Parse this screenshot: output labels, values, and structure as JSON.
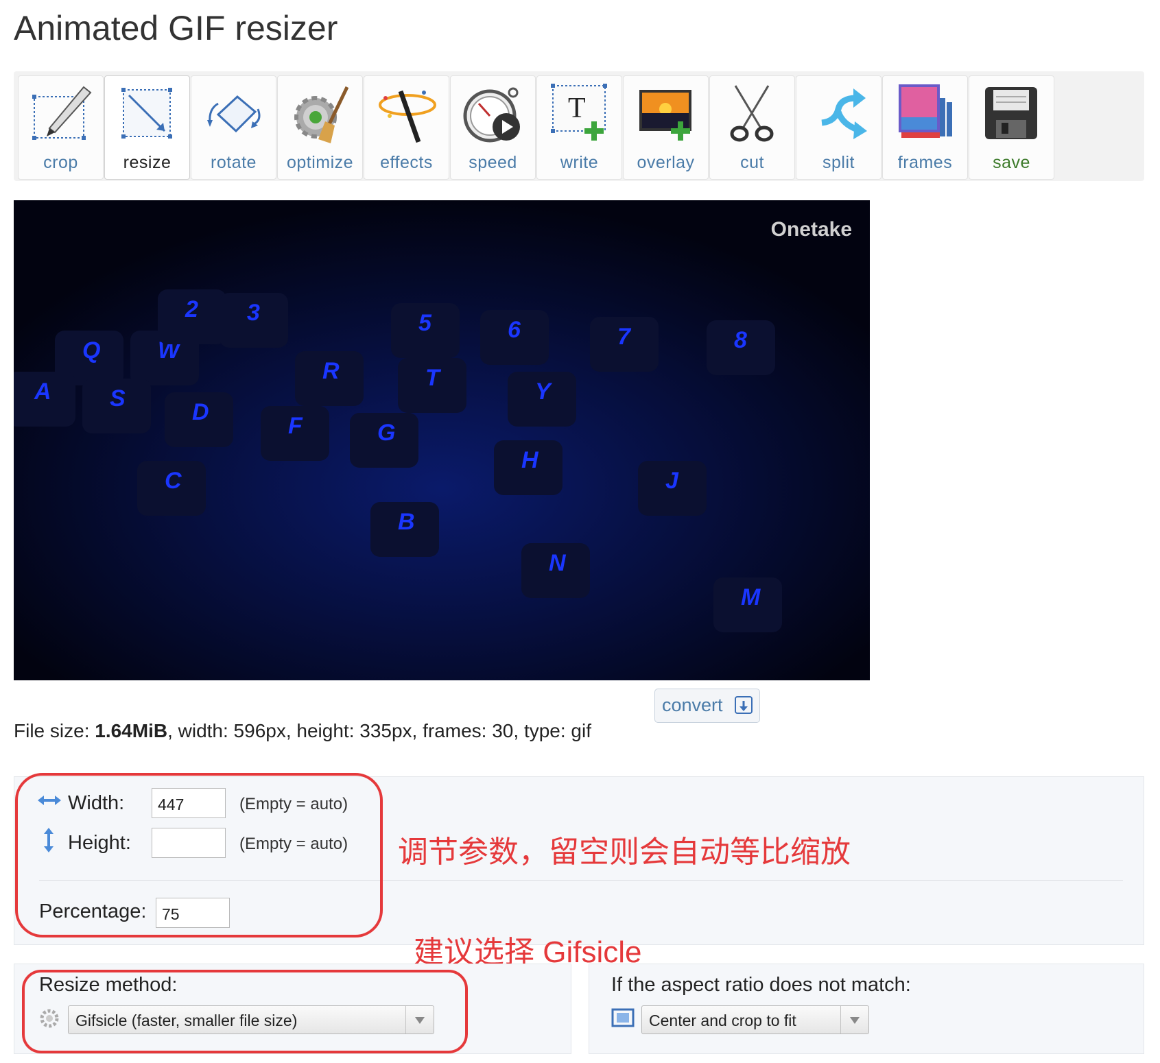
{
  "page": {
    "title": "Animated GIF resizer"
  },
  "toolbar": [
    {
      "label": "crop",
      "icon": "crop-icon"
    },
    {
      "label": "resize",
      "icon": "resize-icon"
    },
    {
      "label": "rotate",
      "icon": "rotate-icon"
    },
    {
      "label": "optimize",
      "icon": "optimize-icon"
    },
    {
      "label": "effects",
      "icon": "effects-icon"
    },
    {
      "label": "speed",
      "icon": "speed-icon"
    },
    {
      "label": "write",
      "icon": "write-icon"
    },
    {
      "label": "overlay",
      "icon": "overlay-icon"
    },
    {
      "label": "cut",
      "icon": "cut-icon"
    },
    {
      "label": "split",
      "icon": "split-icon"
    },
    {
      "label": "frames",
      "icon": "frames-icon"
    },
    {
      "label": "save",
      "icon": "save-icon"
    }
  ],
  "preview": {
    "watermark": "Onetake",
    "keys": [
      "Q",
      "W",
      "R",
      "T",
      "Y",
      "A",
      "S",
      "D",
      "F",
      "G",
      "H",
      "J",
      "C",
      "B",
      "N",
      "M",
      "2",
      "3",
      "5",
      "6",
      "7",
      "8"
    ]
  },
  "convert": {
    "label": "convert"
  },
  "fileinfo": {
    "prefix": "File size: ",
    "size": "1.64MiB",
    "rest": ", width: 596px, height: 335px, frames: 30, type: gif"
  },
  "resize": {
    "width_label": "Width:",
    "width_value": "447",
    "width_hint": "(Empty = auto)",
    "height_label": "Height:",
    "height_value": "",
    "height_hint": "(Empty = auto)",
    "percentage_label": "Percentage:",
    "percentage_value": "75"
  },
  "annotations": {
    "note1": "调节参数，留空则会自动等比缩放",
    "note2": "建议选择 Gifsicle"
  },
  "method": {
    "label": "Resize method:",
    "selected": "Gifsicle (faster, smaller file size)"
  },
  "aspect": {
    "label": "If the aspect ratio does not match:",
    "selected": "Center and crop to fit"
  },
  "colors": {
    "accent_blue": "#4a7ba8",
    "annotation_red": "#e5393b",
    "save_green": "#3c7a2a"
  }
}
